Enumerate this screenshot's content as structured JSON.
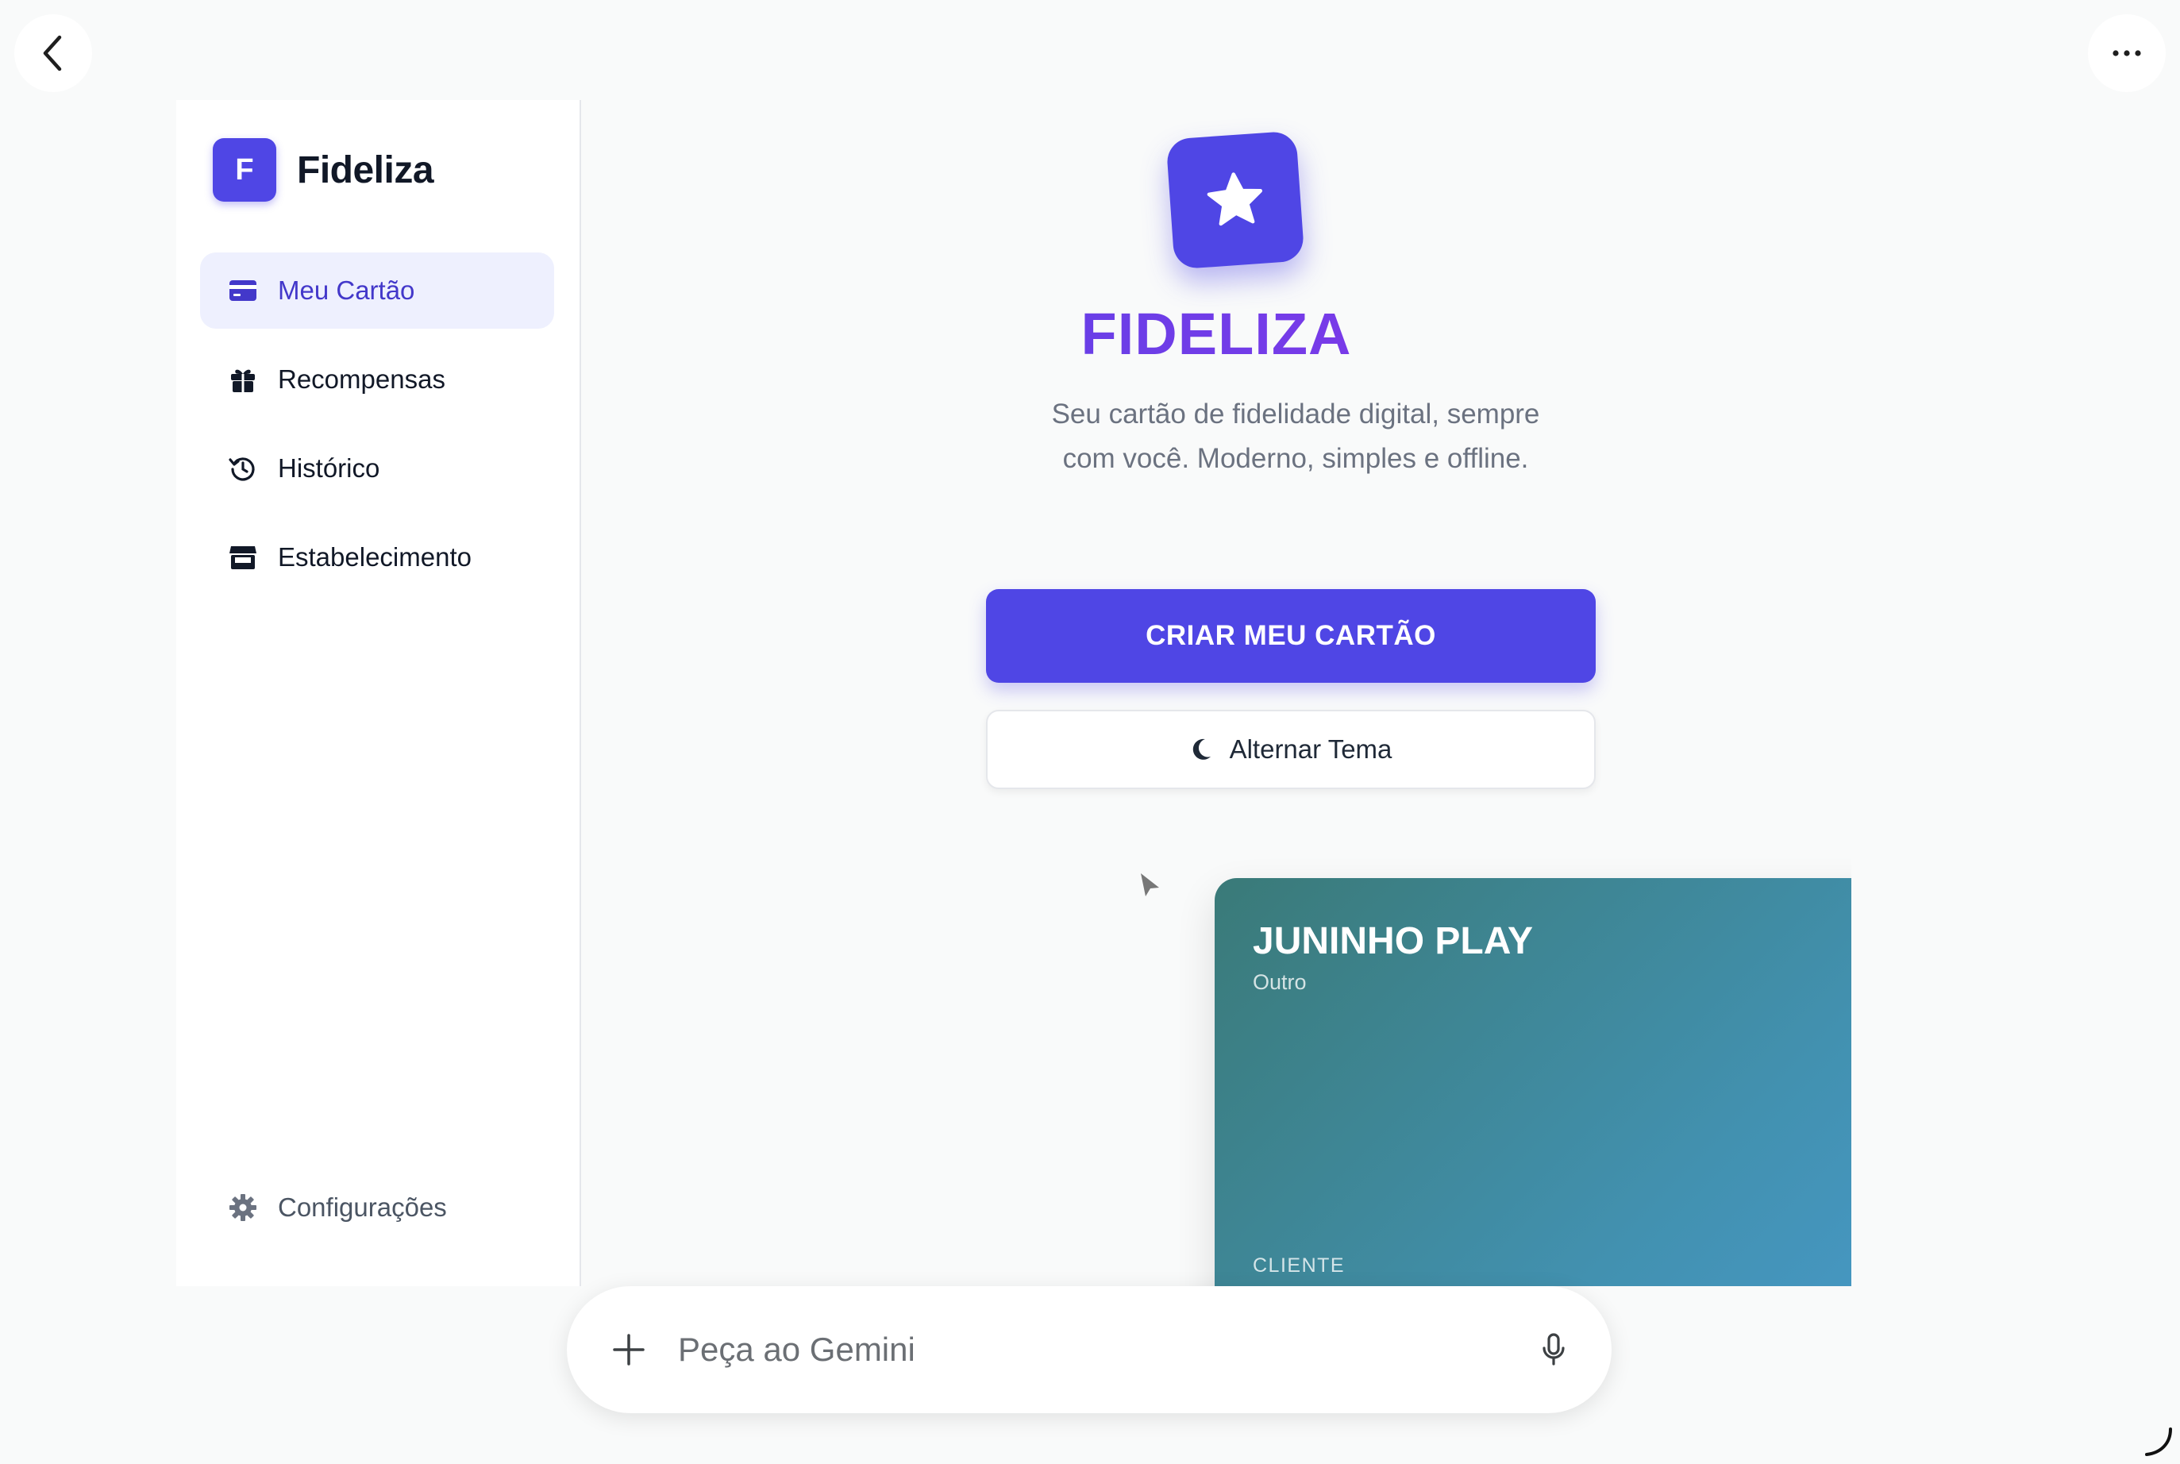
{
  "brand": {
    "logo_letter": "F",
    "name": "Fideliza"
  },
  "sidebar": {
    "items": [
      {
        "label": "Meu Cartão",
        "icon": "credit-card-icon",
        "active": true
      },
      {
        "label": "Recompensas",
        "icon": "gift-icon",
        "active": false
      },
      {
        "label": "Histórico",
        "icon": "history-icon",
        "active": false
      },
      {
        "label": "Estabelecimento",
        "icon": "store-icon",
        "active": false
      }
    ],
    "settings_label": "Configurações",
    "settings_icon": "gear-icon"
  },
  "hero": {
    "icon": "star-icon",
    "title": "FIDELIZA",
    "subtitle": "Seu cartão de fidelidade digital, sempre com você. Moderno, simples e offline.",
    "cta_label": "CRIAR MEU CARTÃO",
    "theme_label": "Alternar Tema",
    "theme_icon": "moon-icon"
  },
  "card": {
    "title": "JUNINHO PLAY",
    "category": "Outro",
    "label": "CLIENTE",
    "badge_icon": "star-icon"
  },
  "gemini": {
    "placeholder": "Peça ao Gemini"
  },
  "colors": {
    "accent": "#4f46e5",
    "accent_soft": "#eef0fe",
    "card_gradient_start": "#3a7a78",
    "card_gradient_end": "#4a9dd5",
    "title_gradient_end": "#9333ea"
  }
}
